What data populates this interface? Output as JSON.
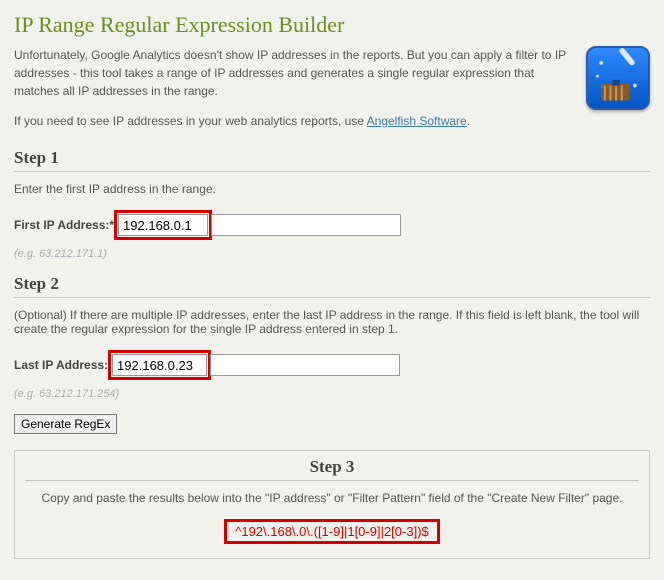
{
  "title": "IP Range Regular Expression Builder",
  "intro_p1": "Unfortunately, Google Analytics doesn't show IP addresses in the reports. But you can apply a filter to IP addresses - this tool takes a range of IP addresses and generates a single regular expression that matches all IP addresses in the range.",
  "need_prefix": "If you need to see IP addresses in your web analytics reports, use ",
  "need_link": "Angelfish Software",
  "need_suffix": ".",
  "step1": {
    "heading": "Step 1",
    "instr": "Enter the first IP address in the range.",
    "label": "First IP Address:",
    "required_mark": "*",
    "value": "192.168.0.1",
    "example": "(e.g. 63.212.171.1)"
  },
  "step2": {
    "heading": "Step 2",
    "instr": "(Optional) If there are multiple IP addresses, enter the last IP address in the range. If this field is left blank, the tool will create the regular expression for the single IP address entered in step 1.",
    "label": "Last IP Address:",
    "value": "192.168.0.23",
    "example": "(e.g. 63.212.171.254)"
  },
  "generate_label": "Generate RegEx",
  "step3": {
    "heading": "Step 3",
    "instr": "Copy and paste the results below into the \"IP address\" or \"Filter Pattern\" field of the \"Create New Filter\" page.",
    "regex": "^192\\.168\\.0\\.([1-9]|1[0-9]|2[0-3])$"
  }
}
